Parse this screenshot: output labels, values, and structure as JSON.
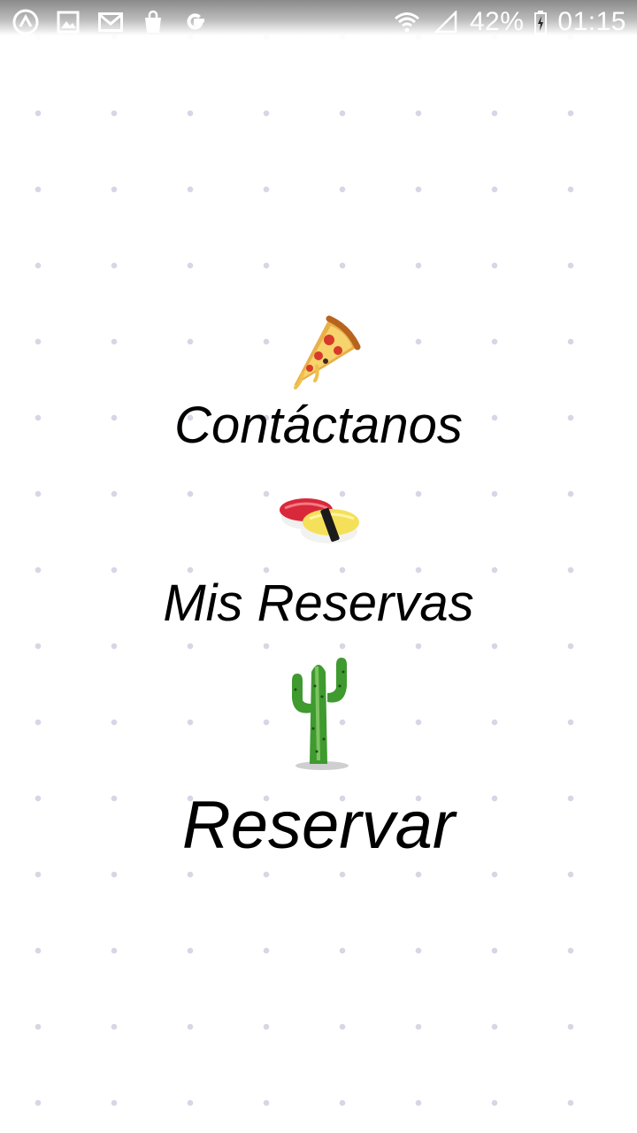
{
  "status_bar": {
    "battery_percent": "42%",
    "time": "01:15",
    "left_icons": [
      "app-logo-icon",
      "image-icon",
      "mail-icon",
      "shopping-bag-icon",
      "google-icon"
    ],
    "right_icons": [
      "wifi-icon",
      "signal-icon",
      "battery-charging-icon"
    ]
  },
  "menu": {
    "items": [
      {
        "label": "Contáctanos",
        "icon": "pizza-icon"
      },
      {
        "label": "Mis Reservas",
        "icon": "sushi-icon"
      },
      {
        "label": "Reservar",
        "icon": "cactus-icon"
      }
    ]
  },
  "colors": {
    "background": "#ffffff",
    "dot_pattern": "#d6d6e6",
    "text": "#000000"
  }
}
